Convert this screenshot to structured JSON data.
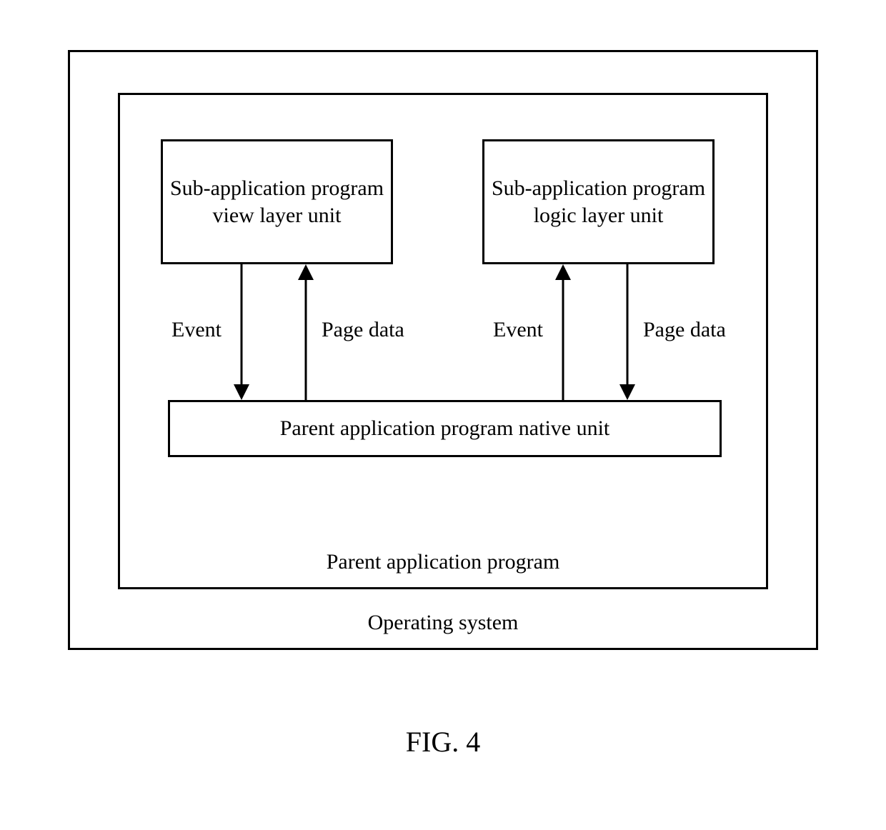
{
  "boxes": {
    "view_layer": "Sub-application program view layer unit",
    "logic_layer": "Sub-application program logic layer unit",
    "parent_native": "Parent application program native unit"
  },
  "labels": {
    "parent_app": "Parent application program",
    "os": "Operating system",
    "figure": "FIG. 4"
  },
  "arrows": {
    "event": "Event",
    "page_data": "Page data"
  }
}
